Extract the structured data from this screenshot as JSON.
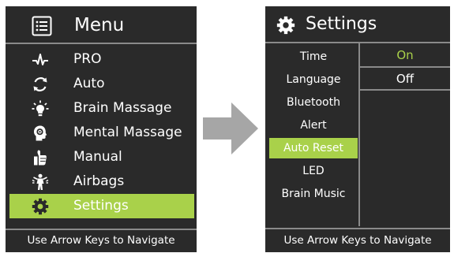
{
  "menu_screen": {
    "header_icon": "list-icon",
    "title": "Menu",
    "items": [
      {
        "label": "PRO",
        "icon": "pulse-icon",
        "selected": false
      },
      {
        "label": "Auto",
        "icon": "cycle-arrows-icon",
        "selected": false
      },
      {
        "label": "Brain Massage",
        "icon": "lightbulb-icon",
        "selected": false
      },
      {
        "label": "Mental Massage",
        "icon": "head-icon",
        "selected": false
      },
      {
        "label": "Manual",
        "icon": "thumbs-up-icon",
        "selected": false
      },
      {
        "label": "Airbags",
        "icon": "person-stretch-icon",
        "selected": false
      },
      {
        "label": "Settings",
        "icon": "gear-icon",
        "selected": true
      }
    ],
    "footer": "Use Arrow Keys to Navigate"
  },
  "transition_icon": "arrow-right-icon",
  "settings_screen": {
    "header_icon": "gear-icon",
    "title": "Settings",
    "items": [
      {
        "label": "Time",
        "selected": false
      },
      {
        "label": "Language",
        "selected": false
      },
      {
        "label": "Bluetooth",
        "selected": false
      },
      {
        "label": "Alert",
        "selected": false
      },
      {
        "label": "Auto Reset",
        "selected": true
      },
      {
        "label": "LED",
        "selected": false
      },
      {
        "label": "Brain Music",
        "selected": false
      }
    ],
    "options": [
      {
        "label": "On",
        "active": true
      },
      {
        "label": "Off",
        "active": false
      }
    ],
    "footer": "Use Arrow Keys to Navigate"
  },
  "colors": {
    "screen_background": "#2a2a2a",
    "highlight": "#a9d14a",
    "divider": "#8a8a8a",
    "text": "#ffffff",
    "arrow": "#a6a6a6"
  }
}
